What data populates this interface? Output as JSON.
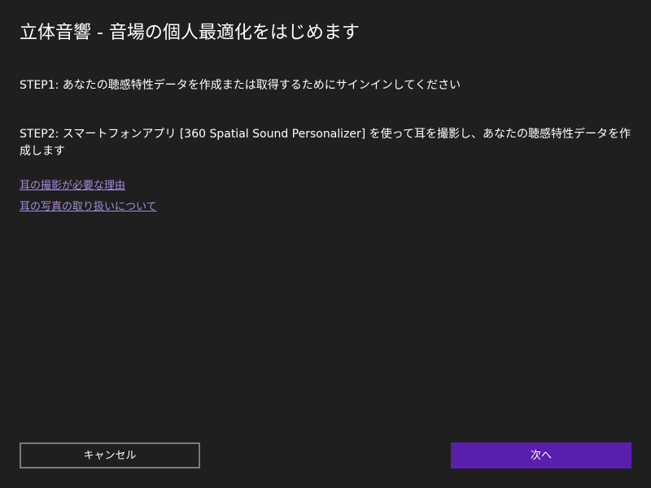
{
  "window": {
    "title": "立体音響 - 音場の個人最適化をはじめます"
  },
  "steps": {
    "step1": "STEP1: あなたの聴感特性データを作成または取得するためにサインインしてください",
    "step2": "STEP2: スマートフォンアプリ [360 Spatial Sound Personalizer] を使って耳を撮影し、あなたの聴感特性データを作成します"
  },
  "links": {
    "why_ear_photo": "耳の撮影が必要な理由",
    "ear_photo_handling": "耳の写真の取り扱いについて"
  },
  "buttons": {
    "cancel_label": "キャンセル",
    "next_label": "次へ"
  },
  "colors": {
    "background": "#1f1f1f",
    "text": "#ffffff",
    "link": "#a78bdc",
    "accent": "#5b1fae",
    "cancel_border": "#7a7a7a"
  }
}
